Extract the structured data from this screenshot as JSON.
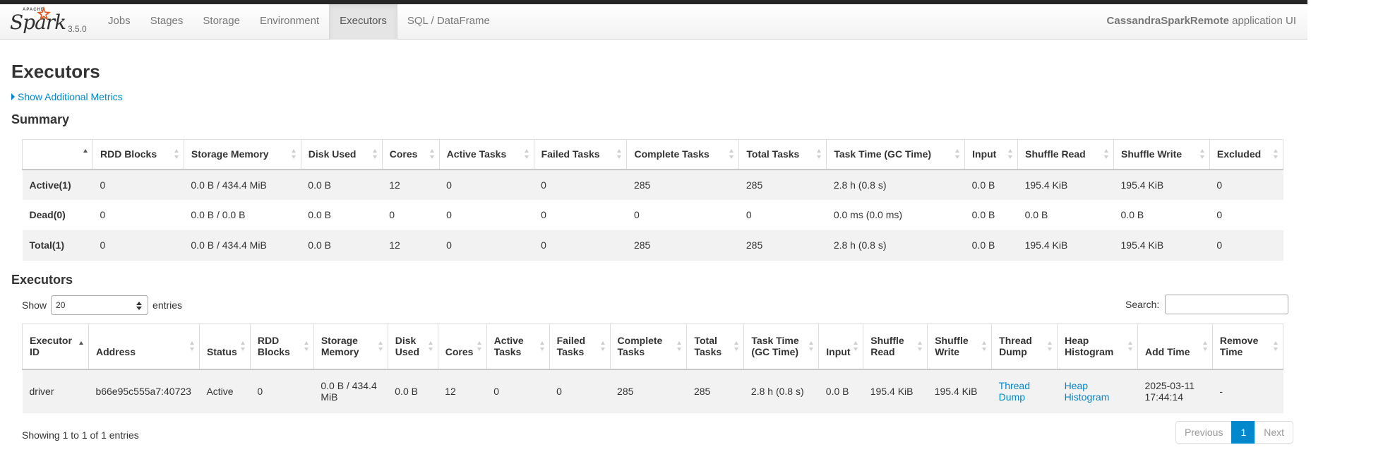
{
  "brand": {
    "apache": "APACHE",
    "name": "Spark",
    "version": "3.5.0"
  },
  "nav": {
    "items": [
      {
        "label": "Jobs",
        "active": false
      },
      {
        "label": "Stages",
        "active": false
      },
      {
        "label": "Storage",
        "active": false
      },
      {
        "label": "Environment",
        "active": false
      },
      {
        "label": "Executors",
        "active": true
      },
      {
        "label": "SQL / DataFrame",
        "active": false
      }
    ],
    "app_name": "CassandraSparkRemote",
    "app_suffix": " application UI"
  },
  "page": {
    "title": "Executors",
    "additional_metrics": "Show Additional Metrics",
    "summary_heading": "Summary",
    "executors_heading": "Executors"
  },
  "summary": {
    "columns": [
      "",
      "RDD Blocks",
      "Storage Memory",
      "Disk Used",
      "Cores",
      "Active Tasks",
      "Failed Tasks",
      "Complete Tasks",
      "Total Tasks",
      "Task Time (GC Time)",
      "Input",
      "Shuffle Read",
      "Shuffle Write",
      "Excluded"
    ],
    "rows": [
      [
        "Active(1)",
        "0",
        "0.0 B / 434.4 MiB",
        "0.0 B",
        "12",
        "0",
        "0",
        "285",
        "285",
        "2.8 h (0.8 s)",
        "0.0 B",
        "195.4 KiB",
        "195.4 KiB",
        "0"
      ],
      [
        "Dead(0)",
        "0",
        "0.0 B / 0.0 B",
        "0.0 B",
        "0",
        "0",
        "0",
        "0",
        "0",
        "0.0 ms (0.0 ms)",
        "0.0 B",
        "0.0 B",
        "0.0 B",
        "0"
      ],
      [
        "Total(1)",
        "0",
        "0.0 B / 434.4 MiB",
        "0.0 B",
        "12",
        "0",
        "0",
        "285",
        "285",
        "2.8 h (0.8 s)",
        "0.0 B",
        "195.4 KiB",
        "195.4 KiB",
        "0"
      ]
    ]
  },
  "executors": {
    "show_label": "Show",
    "entries_value": "20",
    "entries_label": "entries",
    "search_label": "Search:",
    "columns": [
      [
        "Executor",
        "ID"
      ],
      [
        "",
        "Address"
      ],
      [
        "",
        "Status"
      ],
      [
        "RDD",
        "Blocks"
      ],
      [
        "Storage",
        "Memory"
      ],
      [
        "Disk",
        "Used"
      ],
      [
        "",
        "Cores"
      ],
      [
        "Active",
        "Tasks"
      ],
      [
        "Failed",
        "Tasks"
      ],
      [
        "Complete",
        "Tasks"
      ],
      [
        "Total",
        "Tasks"
      ],
      [
        "Task Time",
        "(GC Time)"
      ],
      [
        "",
        "Input"
      ],
      [
        "Shuffle",
        "Read"
      ],
      [
        "Shuffle",
        "Write"
      ],
      [
        "Thread",
        "Dump"
      ],
      [
        "Heap",
        "Histogram"
      ],
      [
        "",
        "Add Time"
      ],
      [
        "Remove",
        "Time"
      ]
    ],
    "row": {
      "id": "driver",
      "address": "b66e95c555a7:40723",
      "status": "Active",
      "rdd_blocks": "0",
      "storage_memory_1": "0.0 B / 434.4",
      "storage_memory_2": "MiB",
      "disk_used": "0.0 B",
      "cores": "12",
      "active_tasks": "0",
      "failed_tasks": "0",
      "complete_tasks": "285",
      "total_tasks": "285",
      "task_time": "2.8 h (0.8 s)",
      "input": "0.0 B",
      "shuffle_read": "195.4 KiB",
      "shuffle_write": "195.4 KiB",
      "thread_dump_1": "Thread",
      "thread_dump_2": "Dump",
      "heap_hist_1": "Heap",
      "heap_hist_2": "Histogram",
      "add_time_1": "2025-03-11",
      "add_time_2": "17:44:14",
      "remove_time": "-"
    },
    "showing": "Showing 1 to 1 of 1 entries",
    "pager": {
      "previous": "Previous",
      "page": "1",
      "next": "Next"
    }
  }
}
